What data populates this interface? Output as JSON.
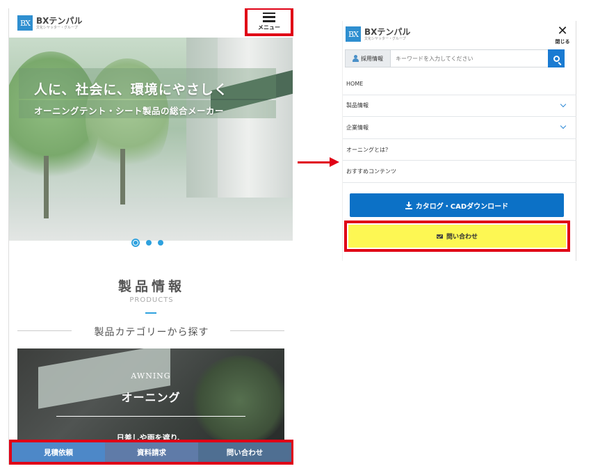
{
  "left_screen": {
    "logo": {
      "mark": "BX",
      "name": "BXテンパル",
      "sub": "文化シヤッター・グループ"
    },
    "menu_label": "メニュー",
    "hero": {
      "headline": "人に、社会に、環境にやさしく",
      "subline": "オーニングテント・シート製品の総合メーカー"
    },
    "carousel": {
      "active_index": 1,
      "count": 3
    },
    "products": {
      "title": "製品情報",
      "subtitle": "PRODUCTS",
      "category_heading": "製品カテゴリーから探す"
    },
    "card": {
      "label_en": "AWNING",
      "label_jp": "オーニング",
      "description": "日差しや雨を遮り、"
    },
    "bottom_bar": {
      "quote": "見積依頼",
      "documents": "資料請求",
      "contact": "問い合わせ"
    }
  },
  "right_screen": {
    "logo": {
      "mark": "BX",
      "name": "BXテンパル",
      "sub": "文化シヤッター・グループ"
    },
    "close_label": "閉じる",
    "recruit_label": "採用情報",
    "search_placeholder": "キーワードを入力してください",
    "menu_items": [
      {
        "label": "HOME",
        "has_submenu": false
      },
      {
        "label": "製品情報",
        "has_submenu": true
      },
      {
        "label": "企業情報",
        "has_submenu": true
      },
      {
        "label": "オーニングとは？",
        "has_submenu": false
      },
      {
        "label": "おすすめコンテンツ",
        "has_submenu": false
      }
    ],
    "download_button": "カタログ・CADダウンロード",
    "contact_button": "問い合わせ"
  },
  "colors": {
    "highlight_frame": "#e00016",
    "brand_blue": "#2f8fd0",
    "download_blue": "#0c71c6",
    "contact_yellow": "#fdf753"
  }
}
